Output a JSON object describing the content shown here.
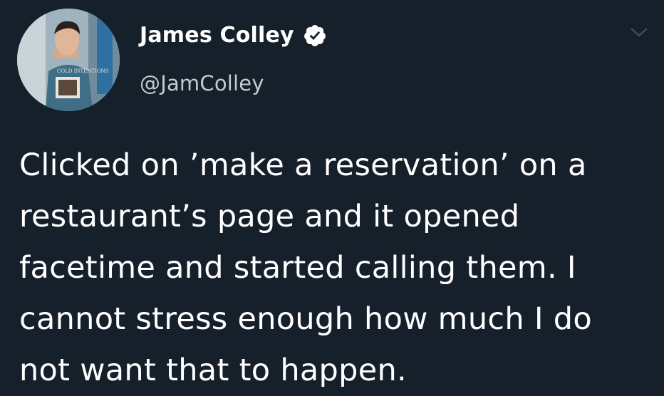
{
  "author": {
    "display_name": "James Colley",
    "handle": "@JamColley",
    "verified": true,
    "avatar_icon": "profile-photo",
    "shirt_text": "COLD INTENTIONS"
  },
  "tweet": {
    "text": "Clicked on ’make a reservation’ on a restaurant’s page and it opened facetime and started calling them. I cannot stress enough how much I do not want that to happen."
  },
  "icons": {
    "verified": "verified-badge-icon",
    "menu": "chevron-down-icon"
  },
  "colors": {
    "background": "#15202b",
    "text": "#ffffff",
    "handle": "#c3ccd3",
    "badge": "#ffffff",
    "chevron": "#3a4f63"
  }
}
